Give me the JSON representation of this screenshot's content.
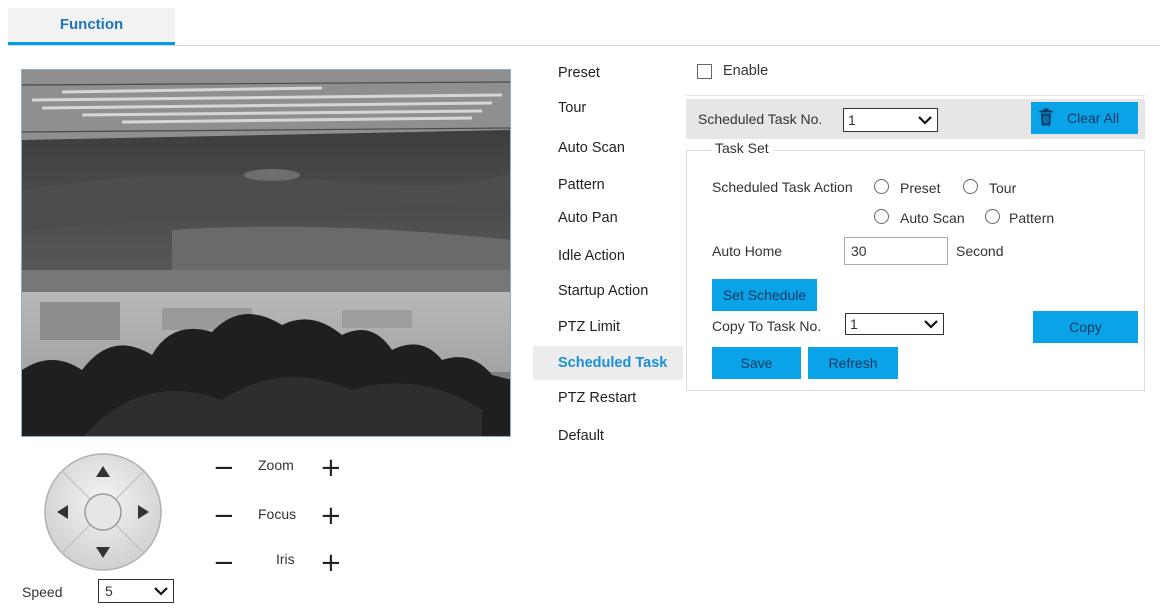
{
  "tabs": [
    {
      "label": "Function",
      "active": true
    }
  ],
  "colors": {
    "accent": "#0aa3e8",
    "active_text": "#1a8fd6",
    "tab_text": "#1a75bb"
  },
  "ptz": {
    "zoom_label": "Zoom",
    "focus_label": "Focus",
    "iris_label": "Iris",
    "minus_symbol": "−",
    "plus_symbol": "+",
    "speed_label": "Speed",
    "speed_value": "5"
  },
  "menu": {
    "items": [
      {
        "label": "Preset"
      },
      {
        "label": "Tour"
      },
      {
        "label": "Auto Scan"
      },
      {
        "label": "Pattern"
      },
      {
        "label": "Auto Pan"
      },
      {
        "label": "Idle Action"
      },
      {
        "label": "Startup Action"
      },
      {
        "label": "PTZ Limit"
      },
      {
        "label": "Scheduled Task",
        "active": true
      },
      {
        "label": "PTZ Restart"
      },
      {
        "label": "Default"
      }
    ]
  },
  "panel": {
    "enable_label": "Enable",
    "enable_checked": false,
    "task_no_label": "Scheduled Task No.",
    "task_no_value": "1",
    "clear_all_label": "Clear All",
    "task_set_legend": "Task Set",
    "task_action_label": "Scheduled Task Action",
    "actions": {
      "preset": "Preset",
      "tour": "Tour",
      "auto_scan": "Auto Scan",
      "pattern": "Pattern"
    },
    "auto_home_label": "Auto Home",
    "auto_home_value": "30",
    "auto_home_unit": "Second",
    "set_schedule_label": "Set Schedule",
    "copy_to_label": "Copy To Task No.",
    "copy_to_value": "1",
    "copy_label": "Copy",
    "save_label": "Save",
    "refresh_label": "Refresh"
  },
  "icons": {
    "trash": "trash-icon",
    "dropdown": "chevron-down-icon"
  }
}
